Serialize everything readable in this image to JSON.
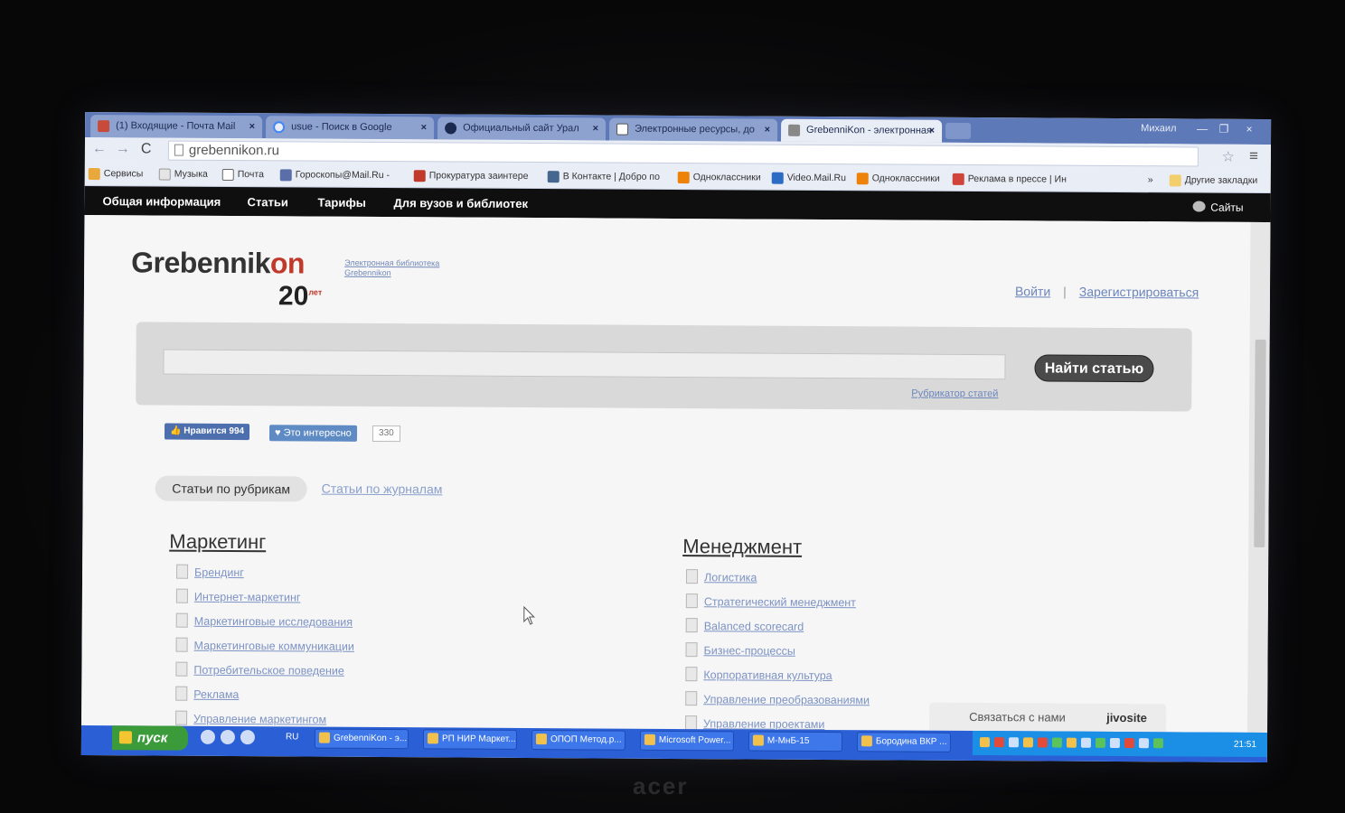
{
  "browser": {
    "tabs": [
      {
        "label": "(1) Входящие - Почта Mail",
        "active": false
      },
      {
        "label": "usue - Поиск в Google",
        "active": false
      },
      {
        "label": "Официальный сайт Урал",
        "active": false
      },
      {
        "label": "Электронные ресурсы, до",
        "active": false
      },
      {
        "label": "GrebenniKon - электронная",
        "active": true
      }
    ],
    "window_user": "Михаил",
    "url": "grebennikon.ru",
    "bookmarks": [
      "Сервисы",
      "Музыка",
      "Почта",
      "Гороскопы@Mail.Ru -",
      "Прокуратура заинтере",
      "В Контакте | Добро по",
      "Одноклассники",
      "Video.Mail.Ru",
      "Одноклассники",
      "Реклама в прессе | Ин",
      "»",
      "Другие закладки"
    ]
  },
  "site": {
    "nav": [
      "Общая информация",
      "Статьи",
      "Тарифы",
      "Для вузов и библиотек"
    ],
    "sites_label": "Сайты",
    "logo_main": "Grebenik",
    "logo_text_a": "Grebennik",
    "logo_text_b": "on",
    "logo_years": "20",
    "logo_years_sup": "лет",
    "logo_subtitle": "Электронная библиотека Grebennikon",
    "login": "Войти",
    "login_sep": "|",
    "register": "Зарегистрироваться",
    "search_button": "Найти статью",
    "rubricator": "Рубрикатор статей",
    "like_label": "Нравится 994",
    "interest_label": "Это интересно",
    "interest_count": "330",
    "tab_active": "Статьи по рубрикам",
    "tab_other": "Статьи по журналам",
    "marketing": {
      "title": "Маркетинг",
      "items": [
        "Брендинг",
        "Интернет-маркетинг",
        "Маркетинговые исследования",
        "Маркетинговые коммуникации",
        "Потребительское поведение",
        "Реклама",
        "Управление маркетингом"
      ]
    },
    "management": {
      "title": "Менеджмент",
      "items": [
        "Логистика",
        "Стратегический менеджмент",
        "Balanced scorecard",
        "Бизнес-процессы",
        "Корпоративная культура",
        "Управление преобразованиями",
        "Управление проектами"
      ]
    },
    "jivo_label": "Связаться с нами",
    "jivo_brand": "jivosite"
  },
  "taskbar": {
    "start": "пуск",
    "lang": "RU",
    "items": [
      "GrebenniKon - э...",
      "РП НИР Маркет...",
      "ОПОП Метод.р...",
      "Microsoft Power...",
      "М-МнБ-15",
      "Бородина ВКР ..."
    ],
    "clock": "21:51"
  },
  "laptop_brand": "acer",
  "colors": {
    "accent_link": "#6c86bc",
    "logo_red": "#c0392b",
    "nav_bg": "#0f0f10",
    "taskbar": "#2a5fd6"
  }
}
